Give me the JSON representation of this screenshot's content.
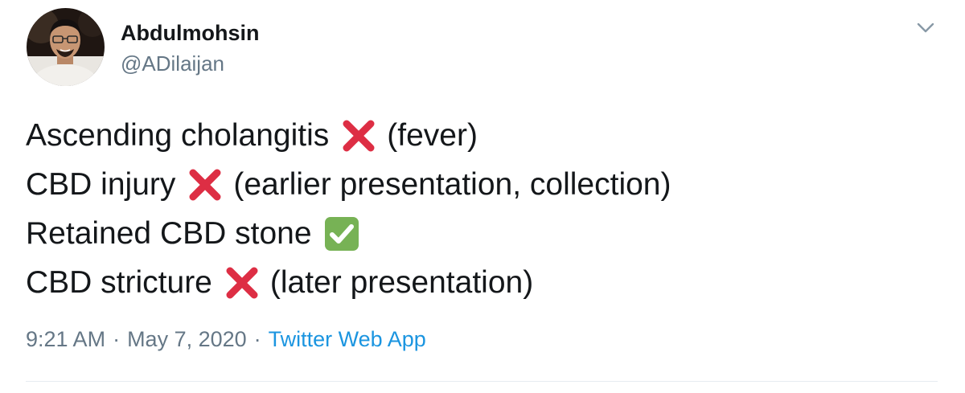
{
  "author": {
    "display_name": "Abdulmohsin",
    "handle": "@ADilaijan",
    "avatar_icon": "user-avatar-photo"
  },
  "tweet": {
    "lines": [
      {
        "before": "Ascending cholangitis",
        "emoji": "cross-mark-icon",
        "after": "(fever)"
      },
      {
        "before": "CBD injury",
        "emoji": "cross-mark-icon",
        "after": "(earlier presentation, collection)"
      },
      {
        "before": "Retained CBD stone",
        "emoji": "check-mark-button-icon",
        "after": ""
      },
      {
        "before": "CBD stricture",
        "emoji": "cross-mark-icon",
        "after": "(later presentation)"
      }
    ]
  },
  "meta": {
    "time": "9:21 AM",
    "separator": "·",
    "date": "May 7, 2020",
    "source": "Twitter Web App"
  },
  "menu": {
    "icon": "chevron-down-icon"
  },
  "colors": {
    "text": "#14171a",
    "secondary": "#657786",
    "link": "#1b95e0",
    "cross": "#dd2e44",
    "check": "#77b255",
    "divider": "#e6ecf0"
  }
}
